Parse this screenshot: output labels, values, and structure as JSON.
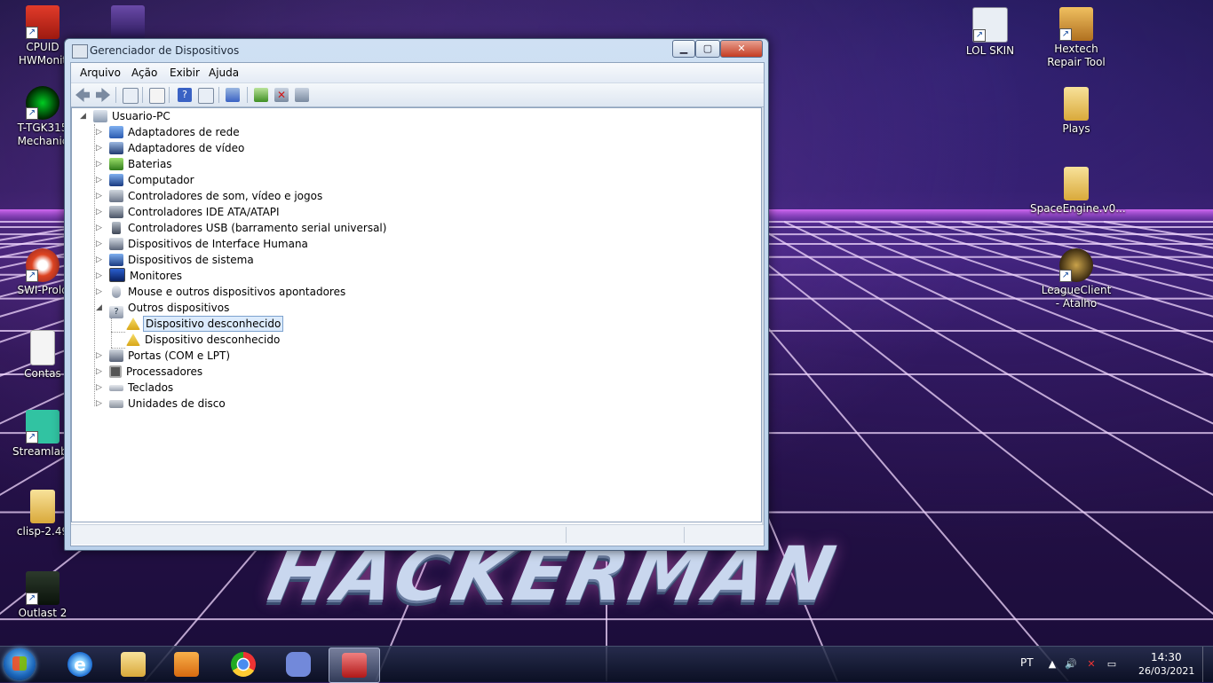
{
  "desktop": {
    "wallpaper_text": "HACKERMAN",
    "icons_left": [
      {
        "label": "CPUID HWMonit",
        "name": "cpuid-hwmonitor"
      },
      {
        "label": "T-TGK315 Mechanic",
        "name": "t-tgk315-mechanic"
      },
      {
        "label": "SWI-Prolo",
        "name": "swi-prolog"
      },
      {
        "label": "Contas",
        "name": "contas"
      },
      {
        "label": "Streamlabs",
        "name": "streamlabs"
      },
      {
        "label": "clisp-2.49",
        "name": "clisp"
      },
      {
        "label": "Outlast 2",
        "name": "outlast-2"
      }
    ],
    "icons_right": [
      {
        "label": "LOL SKIN",
        "name": "lol-skin"
      },
      {
        "label": "Hextech Repair Tool",
        "name": "hextech-repair-tool"
      },
      {
        "label": "Plays",
        "name": "plays"
      },
      {
        "label": "SpaceEngine.v0...",
        "name": "spaceengine"
      },
      {
        "label": "LeagueClient - Atalho",
        "name": "leagueclient-atalho"
      }
    ]
  },
  "window": {
    "title": "Gerenciador de Dispositivos",
    "menu": [
      "Arquivo",
      "Ação",
      "Exibir",
      "Ajuda"
    ],
    "tree": {
      "root": "Usuario-PC",
      "categories": [
        "Adaptadores de rede",
        "Adaptadores de vídeo",
        "Baterias",
        "Computador",
        "Controladores de som, vídeo e jogos",
        "Controladores IDE ATA/ATAPI",
        "Controladores USB (barramento serial universal)",
        "Dispositivos de Interface Humana",
        "Dispositivos de sistema",
        "Monitores",
        "Mouse e outros dispositivos apontadores",
        "Outros dispositivos"
      ],
      "other_devices": [
        "Dispositivo desconhecido",
        "Dispositivo desconhecido"
      ],
      "categories_after": [
        "Portas (COM e LPT)",
        "Processadores",
        "Teclados",
        "Unidades de disco"
      ]
    }
  },
  "taskbar": {
    "language": "PT",
    "time": "14:30",
    "date": "26/03/2021",
    "pinned": [
      "internet-explorer",
      "windows-explorer",
      "media-player",
      "chrome",
      "discord",
      "device-manager"
    ]
  },
  "colors": {
    "accent": "#3b6fc4",
    "selection": "#dcebfc",
    "warning": "#f2c318"
  }
}
